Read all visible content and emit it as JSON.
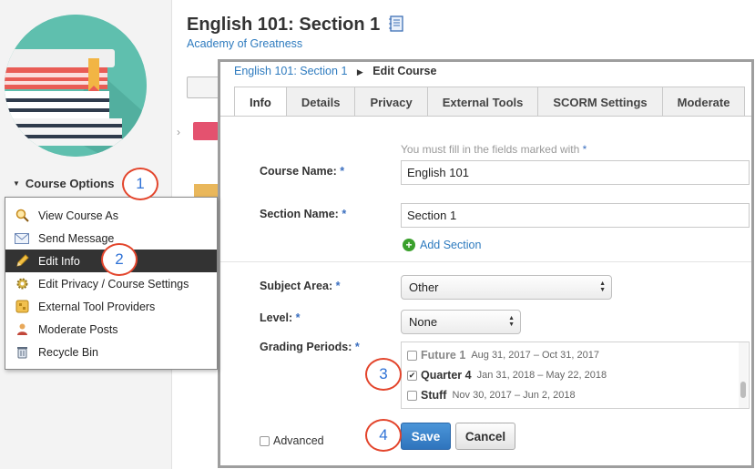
{
  "course": {
    "title": "English 101: Section 1",
    "school": "Academy of Greatness",
    "options_label": "Course Options"
  },
  "menu": {
    "items": [
      {
        "label": "View Course As",
        "icon": "magnifier-icon"
      },
      {
        "label": "Send Message",
        "icon": "envelope-icon"
      },
      {
        "label": "Edit Info",
        "icon": "pencil-icon",
        "active": true
      },
      {
        "label": "Edit Privacy / Course Settings",
        "icon": "gear-icon"
      },
      {
        "label": "External Tool Providers",
        "icon": "tools-icon"
      },
      {
        "label": "Moderate Posts",
        "icon": "person-icon"
      },
      {
        "label": "Recycle Bin",
        "icon": "recycle-icon"
      }
    ]
  },
  "modal": {
    "breadcrumb": {
      "link": "English 101: Section 1",
      "current": "Edit Course"
    },
    "tabs": [
      "Info",
      "Details",
      "Privacy",
      "External Tools",
      "SCORM Settings",
      "Moderate"
    ],
    "active_tab": "Info",
    "required_note": "You must fill in the fields marked with",
    "required_star": "*",
    "fields": {
      "course_name": {
        "label": "Course Name:",
        "value": "English 101"
      },
      "section_name": {
        "label": "Section Name:",
        "value": "Section 1"
      },
      "add_section": "Add Section",
      "subject_area": {
        "label": "Subject Area:",
        "value": "Other"
      },
      "level": {
        "label": "Level:",
        "value": "None"
      },
      "grading_periods": {
        "label": "Grading Periods:",
        "items": [
          {
            "name": "Future 1",
            "dates": "Aug 31, 2017 – Oct 31, 2017",
            "checked": false
          },
          {
            "name": "Quarter 4",
            "dates": "Jan 31, 2018 – May 22, 2018",
            "checked": true
          },
          {
            "name": "Stuff",
            "dates": "Nov 30, 2017 – Jun 2, 2018",
            "checked": false
          }
        ]
      }
    },
    "advanced_label": "Advanced",
    "save_label": "Save",
    "cancel_label": "Cancel"
  },
  "steps": [
    "1",
    "2",
    "3",
    "4"
  ],
  "colors": {
    "accent": "#2e7bbf",
    "step_ring": "#e3452c",
    "save_button": "#3a86cc",
    "menu_active": "#333333"
  }
}
